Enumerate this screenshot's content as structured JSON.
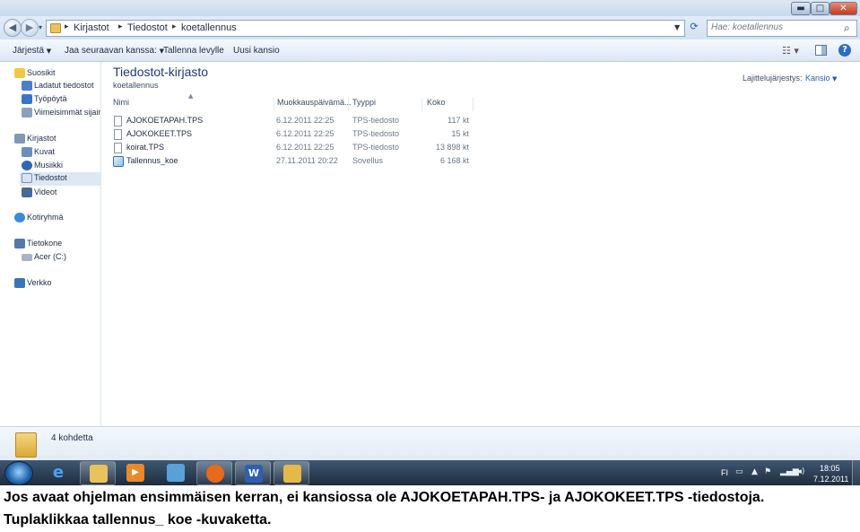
{
  "window": {
    "caption_buttons": {
      "minimize": "▬",
      "maximize": "□",
      "close": "✕"
    }
  },
  "address": {
    "back": "◀",
    "forward": "▶",
    "crumbs": [
      "Kirjastot",
      "Tiedostot",
      "koetallennus"
    ],
    "separator": "▸",
    "search_placeholder": "Hae: koetallennus"
  },
  "commands": {
    "organize": "Järjestä",
    "share": "Jaa seuraavan kanssa:",
    "burn": "Tallenna levylle",
    "new_folder": "Uusi kansio"
  },
  "nav": {
    "favorites": "Suosikit",
    "downloads": "Ladatut tiedostot",
    "desktop": "Työpöytä",
    "recent": "Viimeisimmät sijainnit",
    "libraries": "Kirjastot",
    "pictures": "Kuvat",
    "music": "Musiikki",
    "documents": "Tiedostot",
    "videos": "Videot",
    "homegroup": "Kotiryhmä",
    "computer": "Tietokone",
    "drive": "Acer (C:)",
    "network": "Verkko"
  },
  "library": {
    "title": "Tiedostot-kirjasto",
    "subtitle": "koetallennus",
    "arrange_label": "Lajittelujärjestys:",
    "arrange_value": "Kansio"
  },
  "columns": {
    "name": "Nimi",
    "modified": "Muokkauspäivämä...",
    "type": "Tyyppi",
    "size": "Koko"
  },
  "files": [
    {
      "name": "AJOKOETAPAH.TPS",
      "modified": "6.12.2011 22:25",
      "type": "TPS-tiedosto",
      "size": "117 kt",
      "icon": "file-icon"
    },
    {
      "name": "AJOKOKEET.TPS",
      "modified": "6.12.2011 22:25",
      "type": "TPS-tiedosto",
      "size": "15 kt",
      "icon": "file-icon"
    },
    {
      "name": "koirat.TPS",
      "modified": "6.12.2011 22:25",
      "type": "TPS-tiedosto",
      "size": "13 898 kt",
      "icon": "file-icon"
    },
    {
      "name": "Tallennus_koe",
      "modified": "27.11.2011 20:22",
      "type": "Sovellus",
      "size": "6 168 kt",
      "icon": "application-icon"
    }
  ],
  "details": {
    "count": "4 kohdetta"
  },
  "taskbar": {
    "language": "FI",
    "time": "18:05",
    "date": "7.12.2011",
    "apps": [
      "internet-explorer-icon",
      "file-explorer-icon",
      "media-player-icon",
      "paint-icon",
      "firefox-icon",
      "word-icon",
      "folder-app-icon"
    ],
    "colors": {
      "ie": "#3a8ee6",
      "explorer": "#e9c25b",
      "media": "#e8892b",
      "paint": "#5aa0d8",
      "firefox": "#e86a1c",
      "word": "#2f5fae",
      "folder": "#e5b84a"
    }
  },
  "caption": {
    "line1": "Jos avaat ohjelman ensimmäisen kerran, ei kansiossa ole AJOKOETAPAH.TPS- ja AJOKOKEET.TPS -tiedostoja.",
    "line2": "Tuplaklikkaa tallennus_ koe -kuvaketta."
  }
}
